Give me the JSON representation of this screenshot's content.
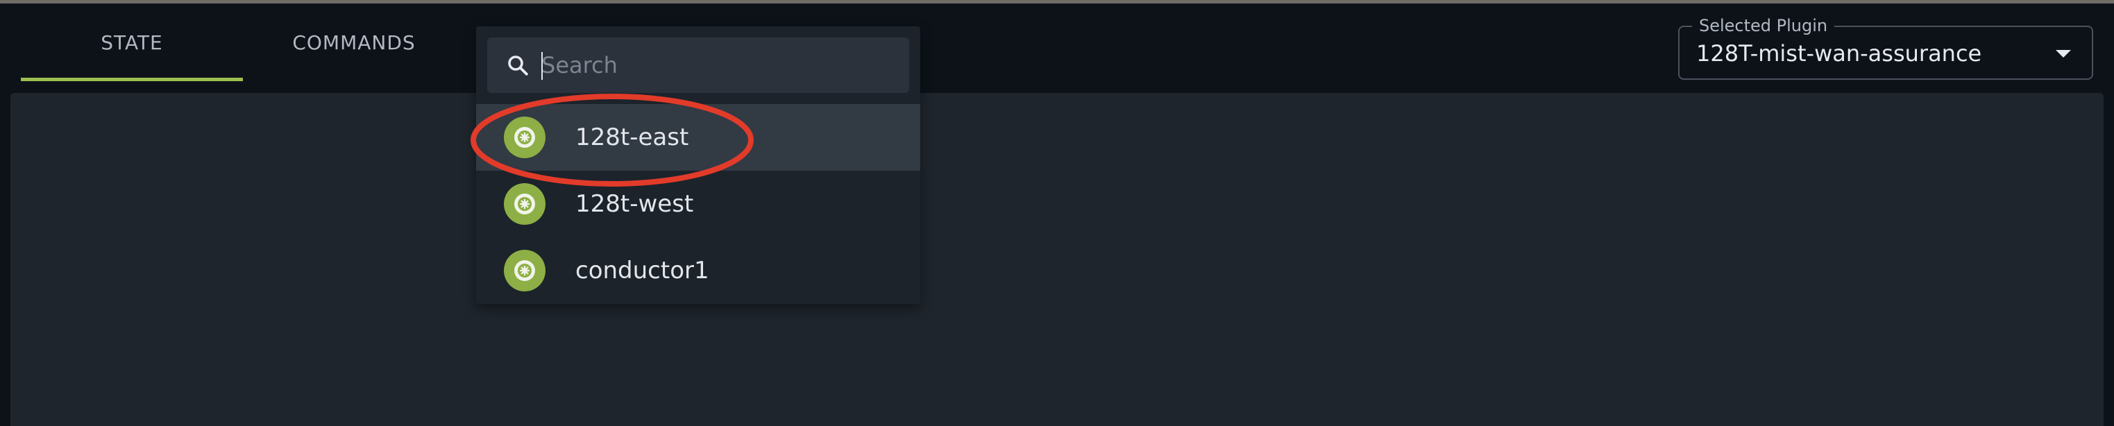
{
  "tabs": [
    {
      "label": "STATE",
      "active": true
    },
    {
      "label": "COMMANDS",
      "active": false
    }
  ],
  "plugin_select": {
    "label": "Selected Plugin",
    "value": "128T-mist-wan-assurance"
  },
  "router_dropdown": {
    "search": {
      "placeholder": "Search",
      "value": ""
    },
    "options": [
      {
        "label": "128t-east",
        "highlighted": true,
        "icon": "router-icon"
      },
      {
        "label": "128t-west",
        "highlighted": false,
        "icon": "router-icon"
      },
      {
        "label": "conductor1",
        "highlighted": false,
        "icon": "router-icon"
      }
    ]
  },
  "annotation": {
    "circle_color": "#e23b2a"
  },
  "colors": {
    "accent": "#9dbf4f",
    "background": "#0d1219",
    "panel": "#1f252d"
  }
}
